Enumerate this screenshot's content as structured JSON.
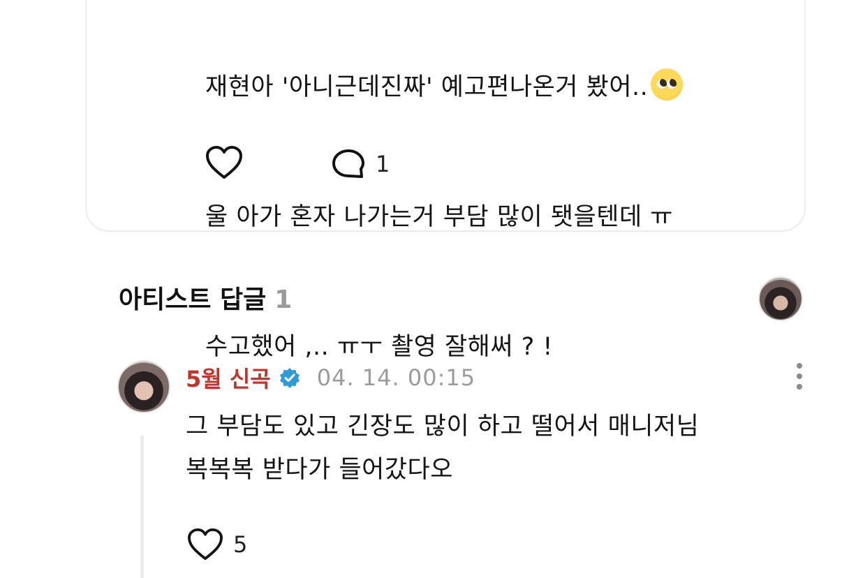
{
  "post": {
    "lines": [
      "재현아 '아니근데진짜' 예고편나온거 봤어..",
      "울 아가 혼자 나가는거 부담 많이 됏을텐데 ㅠ",
      "수고했어 ,.. ㅠㅜ 촬영 잘해써 ? !"
    ],
    "emoji": "pleading-face-emoji",
    "comment_count": "1"
  },
  "artist_replies": {
    "title": "아티스트 답글",
    "count": "1"
  },
  "reply": {
    "author": "5월 신곡",
    "timestamp": "04. 14. 00:15",
    "lines": [
      "그 부담도 있고 긴장도 많이 하고 떨어서 매니저님",
      "복복복 받다가 들어갔다오"
    ],
    "like_count": "5",
    "author_color": "#c4342a",
    "verified_color": "#2f9bd6"
  }
}
